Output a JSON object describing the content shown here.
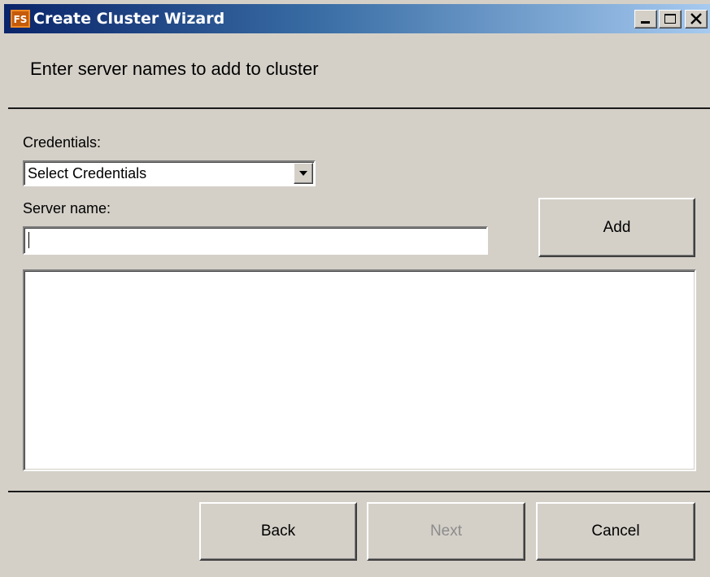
{
  "window": {
    "title": "Create Cluster Wizard",
    "icon": "fs-app-icon",
    "controls": {
      "minimize": "minimize-icon",
      "maximize": "maximize-icon",
      "close": "close-icon"
    }
  },
  "header": {
    "text": "Enter server names to add to cluster"
  },
  "form": {
    "credentials_label": "Credentials:",
    "credentials_selected": "Select Credentials",
    "server_label": "Server name:",
    "server_value": "",
    "add_label": "Add",
    "server_list": []
  },
  "footer": {
    "back_label": "Back",
    "next_label": "Next",
    "cancel_label": "Cancel"
  },
  "colors": {
    "face": "#d4d0c8",
    "title_start": "#0a246a",
    "title_end": "#a6caf0",
    "disabled_text": "#8c8c8c"
  }
}
